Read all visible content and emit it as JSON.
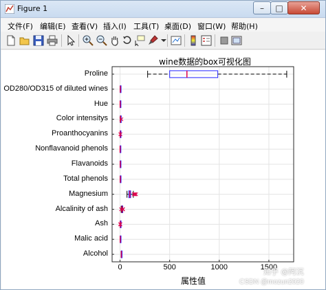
{
  "window": {
    "title": "Figure 1",
    "icon": "matlab-figure-icon",
    "controls": {
      "minimize": "–",
      "maximize": "□",
      "close": "✕"
    }
  },
  "menu": [
    "文件(F)",
    "编辑(E)",
    "查看(V)",
    "插入(I)",
    "工具(T)",
    "桌面(D)",
    "窗口(W)",
    "帮助(H)"
  ],
  "toolbar": [
    "new-figure-icon",
    "open-file-icon",
    "save-icon",
    "print-icon",
    "edit-plot-arrow-icon",
    "zoom-in-icon",
    "zoom-out-icon",
    "pan-hand-icon",
    "rotate-3d-icon",
    "data-cursor-icon",
    "brush-icon",
    "link-plot-icon",
    "insert-colorbar-icon",
    "insert-legend-icon",
    "hide-plot-tools-icon",
    "show-plot-tools-icon"
  ],
  "watermark": {
    "line1": "知乎 @阿沉",
    "line2": "CSDN @mozun2020"
  },
  "colors": {
    "box": "#1f1fff",
    "median": "#e0004d",
    "outlier": "#e0004d",
    "whisker": "#000000"
  },
  "chart_data": {
    "type": "box",
    "orientation": "horizontal",
    "title": "wine数据的box可视化图",
    "xlabel": "属性值",
    "ylabel": "",
    "xlim": [
      -80,
      1750
    ],
    "xticks": [
      0,
      500,
      1000,
      1500
    ],
    "grid": true,
    "categories": [
      "Proline",
      "OD280/OD315 of diluted wines",
      "Hue",
      "Color intensitys",
      "Proanthocyanins",
      "Nonflavanoid phenols",
      "Flavanoids",
      "Total phenols",
      "Magnesium",
      "Alcalinity of ash",
      "Ash",
      "Malic acid",
      "Alcohol"
    ],
    "boxes": [
      {
        "name": "Proline",
        "min": 278,
        "q1": 500,
        "median": 674,
        "q3": 985,
        "max": 1680,
        "outliers": []
      },
      {
        "name": "OD280/OD315 of diluted wines",
        "min": 1.27,
        "q1": 1.94,
        "median": 2.78,
        "q3": 3.17,
        "max": 4.0,
        "outliers": []
      },
      {
        "name": "Hue",
        "min": 0.48,
        "q1": 0.78,
        "median": 0.97,
        "q3": 1.12,
        "max": 1.71,
        "outliers": []
      },
      {
        "name": "Color intensitys",
        "min": 1.28,
        "q1": 3.2,
        "median": 4.69,
        "q3": 6.2,
        "max": 10.8,
        "outliers": [
          13.0
        ]
      },
      {
        "name": "Proanthocyanins",
        "min": 0.41,
        "q1": 1.25,
        "median": 1.56,
        "q3": 1.95,
        "max": 2.96,
        "outliers": [
          3.28,
          3.58
        ]
      },
      {
        "name": "Nonflavanoid phenols",
        "min": 0.13,
        "q1": 0.27,
        "median": 0.34,
        "q3": 0.44,
        "max": 0.66,
        "outliers": []
      },
      {
        "name": "Flavanoids",
        "min": 0.34,
        "q1": 1.2,
        "median": 2.13,
        "q3": 2.88,
        "max": 5.08,
        "outliers": []
      },
      {
        "name": "Total phenols",
        "min": 0.98,
        "q1": 1.74,
        "median": 2.35,
        "q3": 2.8,
        "max": 3.88,
        "outliers": []
      },
      {
        "name": "Magnesium",
        "min": 70,
        "q1": 88,
        "median": 98,
        "q3": 107,
        "max": 134,
        "outliers": [
          139,
          142,
          151,
          151,
          162
        ]
      },
      {
        "name": "Alcalinity of ash",
        "min": 11.2,
        "q1": 17.2,
        "median": 19.5,
        "q3": 21.5,
        "max": 27.0,
        "outliers": [
          10.6,
          28.5,
          30.0,
          30.0
        ]
      },
      {
        "name": "Ash",
        "min": 1.7,
        "q1": 2.21,
        "median": 2.36,
        "q3": 2.56,
        "max": 3.07,
        "outliers": [
          1.36,
          3.22,
          3.23
        ]
      },
      {
        "name": "Malic acid",
        "min": 0.74,
        "q1": 1.6,
        "median": 1.87,
        "q3": 3.08,
        "max": 5.8,
        "outliers": []
      },
      {
        "name": "Alcohol",
        "min": 11.03,
        "q1": 12.36,
        "median": 13.05,
        "q3": 13.68,
        "max": 14.83,
        "outliers": []
      }
    ]
  }
}
